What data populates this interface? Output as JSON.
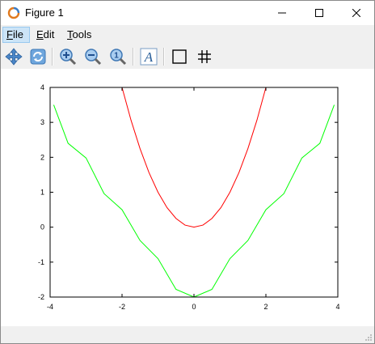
{
  "window": {
    "title": "Figure 1",
    "controls": {
      "minimize": "minimize",
      "maximize": "maximize",
      "close": "close"
    }
  },
  "menu": {
    "items": [
      {
        "label": "File",
        "mnemonic": "F",
        "rest": "ile"
      },
      {
        "label": "Edit",
        "mnemonic": "E",
        "rest": "dit"
      },
      {
        "label": "Tools",
        "mnemonic": "T",
        "rest": "ools"
      }
    ]
  },
  "toolbar": {
    "tools": [
      "pan-icon",
      "rotate-icon",
      "zoom-in-icon",
      "zoom-out-icon",
      "reset-zoom-icon",
      "text-icon",
      "axes-box-icon",
      "grid-icon"
    ],
    "text_tool_glyph": "A"
  },
  "chart_data": {
    "type": "line",
    "title": "",
    "xlabel": "",
    "ylabel": "",
    "xlim": [
      -4,
      4
    ],
    "ylim": [
      -2,
      4
    ],
    "xticks": [
      -4,
      -2,
      0,
      2,
      4
    ],
    "yticks": [
      -2,
      -1,
      0,
      1,
      2,
      3,
      4
    ],
    "grid": false,
    "series": [
      {
        "color": "#ff0000",
        "x": [
          -2.0,
          -1.75,
          -1.5,
          -1.25,
          -1.0,
          -0.75,
          -0.5,
          -0.25,
          0,
          0.25,
          0.5,
          0.75,
          1.0,
          1.25,
          1.5,
          1.75,
          2.0
        ],
        "y": [
          4.0,
          3.06,
          2.25,
          1.56,
          1.0,
          0.56,
          0.25,
          0.06,
          0.0,
          0.06,
          0.25,
          0.56,
          1.0,
          1.56,
          2.25,
          3.06,
          4.0
        ]
      },
      {
        "color": "#00ff00",
        "x": [
          -3.9,
          -3.5,
          -3.0,
          -2.5,
          -2.0,
          -1.5,
          -1.0,
          -0.5,
          0,
          0.5,
          1.0,
          1.5,
          2.0,
          2.5,
          3.0,
          3.5,
          3.9
        ],
        "y": [
          3.5,
          2.4,
          1.98,
          0.96,
          0.5,
          -0.38,
          -0.9,
          -1.78,
          -2.0,
          -1.78,
          -0.9,
          -0.38,
          0.5,
          0.96,
          1.98,
          2.4,
          3.5
        ]
      }
    ]
  }
}
